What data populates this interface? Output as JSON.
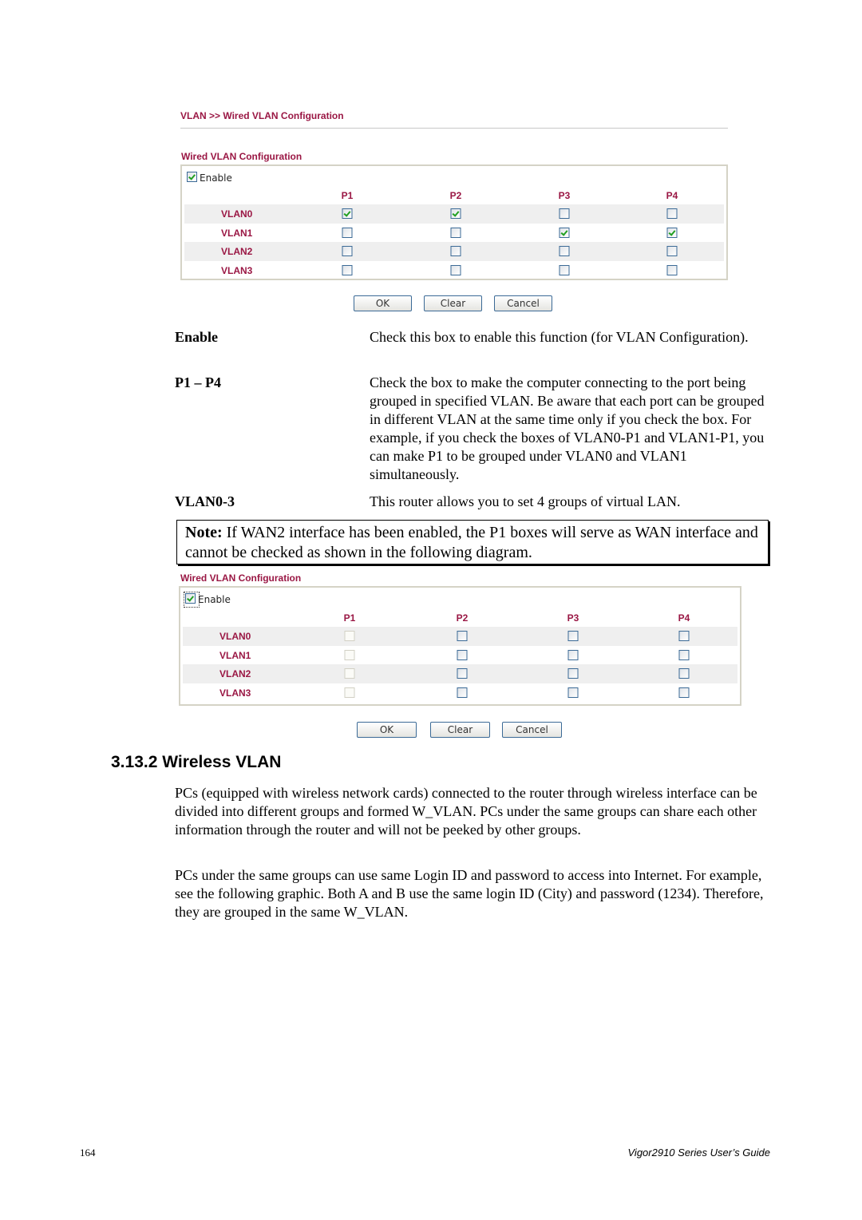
{
  "breadcrumb": "VLAN >> Wired VLAN Configuration",
  "panel1": {
    "title": "Wired VLAN Configuration",
    "enable_label": "Enable",
    "enable_checked": true,
    "ports": [
      "P1",
      "P2",
      "P3",
      "P4"
    ],
    "rows": [
      {
        "label": "VLAN0",
        "checked": [
          true,
          true,
          false,
          false
        ]
      },
      {
        "label": "VLAN1",
        "checked": [
          false,
          false,
          true,
          true
        ]
      },
      {
        "label": "VLAN2",
        "checked": [
          false,
          false,
          false,
          false
        ]
      },
      {
        "label": "VLAN3",
        "checked": [
          false,
          false,
          false,
          false
        ]
      }
    ],
    "buttons": {
      "ok": "OK",
      "clear": "Clear",
      "cancel": "Cancel"
    }
  },
  "descriptions": [
    {
      "term": "Enable",
      "text": "Check this box to enable this function (for VLAN Configuration)."
    },
    {
      "term": "P1 – P4",
      "text": "Check the box to make the computer connecting to the port being grouped in specified VLAN. Be aware that each port can be grouped in different VLAN at the same time only if you check the box. For example, if you check the boxes of VLAN0-P1 and VLAN1-P1, you can make P1 to be grouped under VLAN0 and VLAN1 simultaneously."
    },
    {
      "term": "VLAN0-3",
      "text": "This router allows you to set 4 groups of virtual LAN."
    }
  ],
  "note": {
    "label": "Note:",
    "text": " If WAN2 interface has been enabled, the P1 boxes will serve as WAN interface and cannot be checked as shown in the following diagram."
  },
  "panel2": {
    "title": "Wired VLAN Configuration",
    "enable_label": "Enable",
    "enable_checked": true,
    "ports": [
      "P1",
      "P2",
      "P3",
      "P4"
    ],
    "disabled_port": "P1",
    "rows": [
      {
        "label": "VLAN0",
        "checked": [
          false,
          false,
          false,
          false
        ]
      },
      {
        "label": "VLAN1",
        "checked": [
          false,
          false,
          false,
          false
        ]
      },
      {
        "label": "VLAN2",
        "checked": [
          false,
          false,
          false,
          false
        ]
      },
      {
        "label": "VLAN3",
        "checked": [
          false,
          false,
          false,
          false
        ]
      }
    ],
    "buttons": {
      "ok": "OK",
      "clear": "Clear",
      "cancel": "Cancel"
    }
  },
  "section": {
    "heading": "3.13.2 Wireless VLAN",
    "paragraphs": [
      "PCs (equipped with wireless network cards) connected to the router through wireless interface can be divided into different groups and formed W_VLAN. PCs under the same groups can share each other information through the router and will not be peeked by other groups.",
      "PCs under the same groups can use same Login ID and password to access into Internet. For example, see the following graphic. Both A and B use the same login ID (City) and password (1234). Therefore, they are grouped in the same W_VLAN."
    ]
  },
  "footer": {
    "page_number": "164",
    "title": "Vigor2910 Series User’s Guide"
  }
}
